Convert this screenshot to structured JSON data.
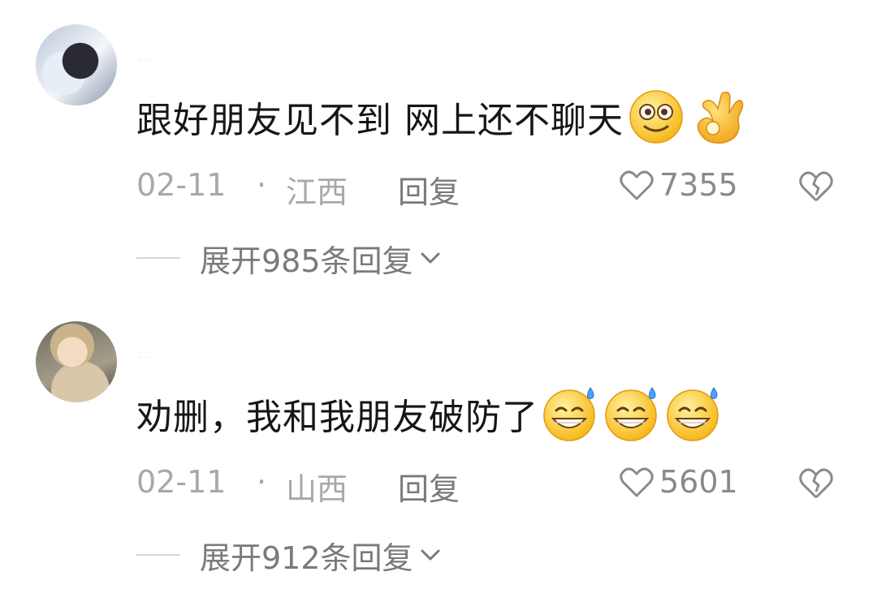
{
  "comments": [
    {
      "avatar": "user-avatar-dark-hood",
      "username": "· ·",
      "text": "跟好朋友见不到 网上还不聊天",
      "emojis": [
        "eyes-smile-emoji",
        "ok-hand-emoji"
      ],
      "date": "02-11",
      "separator": "·",
      "location": "江西",
      "reply_label": "回复",
      "likes": "7355",
      "expand_label": "展开985条回复"
    },
    {
      "avatar": "user-avatar-light-hair",
      "username": "· ·",
      "text": "劝删，我和我朋友破防了",
      "emojis": [
        "grin-sweat-emoji",
        "grin-sweat-emoji",
        "grin-sweat-emoji"
      ],
      "date": "02-11",
      "separator": "·",
      "location": "山西",
      "reply_label": "回复",
      "likes": "5601",
      "expand_label": "展开912条回复"
    }
  ],
  "colors": {
    "text_primary": "#161616",
    "text_meta": "#a8a8a8",
    "text_action": "#7a7a7a",
    "emoji_yellow": "#ffce3a"
  }
}
